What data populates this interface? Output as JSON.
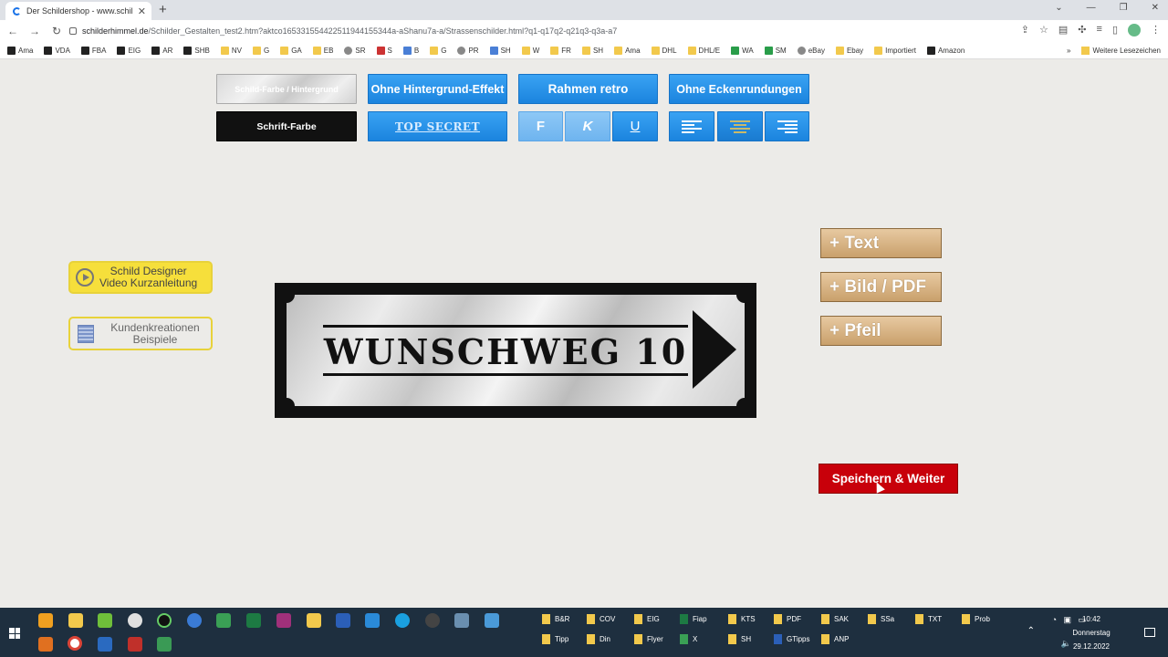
{
  "browser": {
    "tab_title": "Der Schildershop - www.schilderhi",
    "tab_close": "✕",
    "new_tab": "+",
    "url_domain": "schilderhimmel.de",
    "url_path": "/Schilder_Gestalten_test2.htm?aktco165331554422511944155344a-aShanu7a-a/Strassenschilder.html?q1-q17q2-q21q3-q3a-a7",
    "bookmarks": [
      "Ama",
      "VDA",
      "FBA",
      "EIG",
      "AR",
      "SHB",
      "NV",
      "G",
      "GA",
      "EB",
      "SR",
      "S",
      "B",
      "G",
      "PR",
      "SH",
      "W",
      "FR",
      "SH",
      "Ama",
      "DHL",
      "DHL/E",
      "WA",
      "SM",
      "eBay",
      "Ebay",
      "Importiert",
      "Amazon"
    ],
    "bookmarks_more": "»",
    "bookmarks_other": "Weitere Lesezeichen"
  },
  "toolbar": {
    "bg_color_btn": "Schild-Farbe / Hintergrund",
    "font_color_btn": "Schrift-Farbe",
    "no_bg_effect": "Ohne Hintergrund-Effekt",
    "font_style": "TOP SECRET",
    "frame_retro": "Rahmen retro",
    "bold": "F",
    "italic": "K",
    "underline": "U",
    "no_corners": "Ohne Eckenrundungen"
  },
  "tutorials": {
    "video_line1": "Schild Designer",
    "video_line2": "Video Kurzanleitung",
    "kunden_line1": "Kundenkreationen",
    "kunden_line2": "Beispiele"
  },
  "sign": {
    "text": "WUNSCHWEG 10"
  },
  "add_buttons": {
    "text": "+ Text",
    "image": "+ Bild / PDF",
    "arrow": "+ Pfeil"
  },
  "save_button": "Speichern & Weiter",
  "taskbar": {
    "folders_row1": [
      "B&R",
      "COV",
      "EIG",
      "Fiap",
      "KTS",
      "PDF",
      "SAK",
      "SSa",
      "TXT",
      "Prob"
    ],
    "folders_row2": [
      "Tipp",
      "Din",
      "Flyer",
      "X",
      "SH",
      "GTipps",
      "ANP"
    ],
    "time": "10:42",
    "day": "Donnerstag",
    "date": "29.12.2022"
  },
  "colors": {
    "accent_blue": "#1b84de",
    "save_red": "#c8000a",
    "add_gold": "#c9a06b",
    "tutorial_yellow": "#f6df3b"
  }
}
